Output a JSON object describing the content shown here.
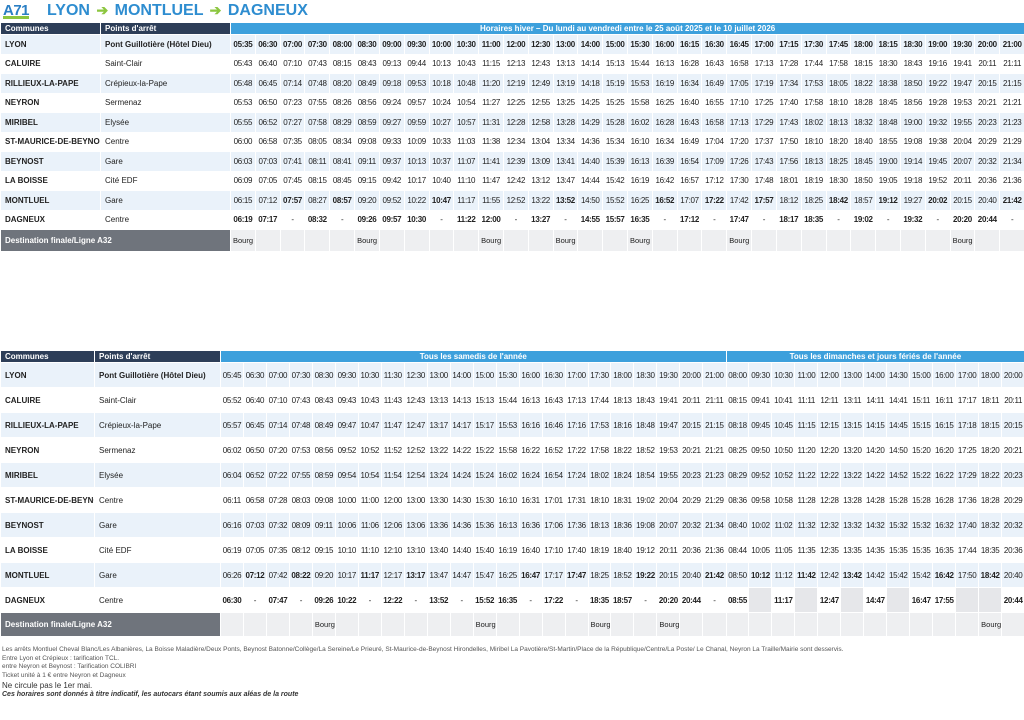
{
  "header": {
    "line": "A71",
    "from": "LYON",
    "via": "MONTLUEL",
    "to": "DAGNEUX"
  },
  "t1": {
    "col_communes": "Communes",
    "col_points": "Points d'arrêt",
    "banner": "Horaires hiver – Du lundi au vendredi entre le 25 août 2025 et le 10 juillet 2026",
    "times": [
      "05:35",
      "06:30",
      "07:00",
      "07:30",
      "08:00",
      "08:30",
      "09:00",
      "09:30",
      "10:00",
      "10:30",
      "11:00",
      "12:00",
      "12:30",
      "13:00",
      "14:00",
      "15:00",
      "15:30",
      "16:00",
      "16:15",
      "16:30",
      "16:45",
      "17:00",
      "17:15",
      "17:30",
      "17:45",
      "18:00",
      "18:15",
      "18:30",
      "19:00",
      "19:30",
      "20:00",
      "21:00"
    ],
    "rows": [
      {
        "commune": "LYON",
        "stop": "Pont Guillotière  (Hôtel Dieu)",
        "bold": true,
        "times": [
          "05:35",
          "06:30",
          "07:00",
          "07:30",
          "08:00",
          "08:30",
          "09:00",
          "09:30",
          "10:00",
          "10:30",
          "11:00",
          "12:00",
          "12:30",
          "13:00",
          "14:00",
          "15:00",
          "15:30",
          "16:00",
          "16:15",
          "16:30",
          "16:45",
          "17:00",
          "17:15",
          "17:30",
          "17:45",
          "18:00",
          "18:15",
          "18:30",
          "19:00",
          "19:30",
          "20:00",
          "21:00"
        ]
      },
      {
        "commune": "CALUIRE",
        "stop": "Saint-Clair",
        "times": [
          "05:43",
          "06:40",
          "07:10",
          "07:43",
          "08:15",
          "08:43",
          "09:13",
          "09:44",
          "10:13",
          "10:43",
          "11:15",
          "12:13",
          "12:43",
          "13:13",
          "14:14",
          "15:13",
          "15:44",
          "16:13",
          "16:28",
          "16:43",
          "16:58",
          "17:13",
          "17:28",
          "17:44",
          "17:58",
          "18:15",
          "18:30",
          "18:43",
          "19:16",
          "19:41",
          "20:11",
          "21:11"
        ]
      },
      {
        "commune": "RILLIEUX-LA-PAPE",
        "stop": "Crépieux-la-Pape",
        "times": [
          "05:48",
          "06:45",
          "07:14",
          "07:48",
          "08:20",
          "08:49",
          "09:18",
          "09:53",
          "10:18",
          "10:48",
          "11:20",
          "12:19",
          "12:49",
          "13:19",
          "14:18",
          "15:19",
          "15:53",
          "16:19",
          "16:34",
          "16:49",
          "17:05",
          "17:19",
          "17:34",
          "17:53",
          "18:05",
          "18:22",
          "18:38",
          "18:50",
          "19:22",
          "19:47",
          "20:15",
          "21:15"
        ]
      },
      {
        "commune": "NEYRON",
        "stop": "Sermenaz",
        "times": [
          "05:53",
          "06:50",
          "07:23",
          "07:55",
          "08:26",
          "08:56",
          "09:24",
          "09:57",
          "10:24",
          "10:54",
          "11:27",
          "12:25",
          "12:55",
          "13:25",
          "14:25",
          "15:25",
          "15:58",
          "16:25",
          "16:40",
          "16:55",
          "17:10",
          "17:25",
          "17:40",
          "17:58",
          "18:10",
          "18:28",
          "18:45",
          "18:56",
          "19:28",
          "19:53",
          "20:21",
          "21:21"
        ]
      },
      {
        "commune": "MIRIBEL",
        "stop": "Elysée",
        "times": [
          "05:55",
          "06:52",
          "07:27",
          "07:58",
          "08:29",
          "08:59",
          "09:27",
          "09:59",
          "10:27",
          "10:57",
          "11:31",
          "12:28",
          "12:58",
          "13:28",
          "14:29",
          "15:28",
          "16:02",
          "16:28",
          "16:43",
          "16:58",
          "17:13",
          "17:29",
          "17:43",
          "18:02",
          "18:13",
          "18:32",
          "18:48",
          "19:00",
          "19:32",
          "19:55",
          "20:23",
          "21:23"
        ]
      },
      {
        "commune": "ST-MAURICE-DE-BEYNOST",
        "stop": "Centre",
        "times": [
          "06:00",
          "06:58",
          "07:35",
          "08:05",
          "08:34",
          "09:08",
          "09:33",
          "10:09",
          "10:33",
          "11:03",
          "11:38",
          "12:34",
          "13:04",
          "13:34",
          "14:36",
          "15:34",
          "16:10",
          "16:34",
          "16:49",
          "17:04",
          "17:20",
          "17:37",
          "17:50",
          "18:10",
          "18:20",
          "18:40",
          "18:55",
          "19:08",
          "19:38",
          "20:04",
          "20:29",
          "21:29"
        ]
      },
      {
        "commune": "BEYNOST",
        "stop": "Gare",
        "times": [
          "06:03",
          "07:03",
          "07:41",
          "08:11",
          "08:41",
          "09:11",
          "09:37",
          "10:13",
          "10:37",
          "11:07",
          "11:41",
          "12:39",
          "13:09",
          "13:41",
          "14:40",
          "15:39",
          "16:13",
          "16:39",
          "16:54",
          "17:09",
          "17:26",
          "17:43",
          "17:56",
          "18:13",
          "18:25",
          "18:45",
          "19:00",
          "19:14",
          "19:45",
          "20:07",
          "20:32",
          "21:34"
        ]
      },
      {
        "commune": "LA BOISSE",
        "stop": "Cité EDF",
        "times": [
          "06:09",
          "07:05",
          "07:45",
          "08:15",
          "08:45",
          "09:15",
          "09:42",
          "10:17",
          "10:40",
          "11:10",
          "11:47",
          "12:42",
          "13:12",
          "13:47",
          "14:44",
          "15:42",
          "16:19",
          "16:42",
          "16:57",
          "17:12",
          "17:30",
          "17:48",
          "18:01",
          "18:19",
          "18:30",
          "18:50",
          "19:05",
          "19:18",
          "19:52",
          "20:11",
          "20:36",
          "21:36"
        ]
      },
      {
        "commune": "MONTLUEL",
        "stop": "Gare",
        "times": [
          "06:15",
          "07:12",
          "07:57",
          "08:27",
          "08:57",
          "09:20",
          "09:52",
          "10:22",
          "10:47",
          "11:17",
          "11:55",
          "12:52",
          "13:22",
          "13:52",
          "14:50",
          "15:52",
          "16:25",
          "16:52",
          "17:07",
          "17:22",
          "17:42",
          "17:57",
          "18:12",
          "18:25",
          "18:42",
          "18:57",
          "19:12",
          "19:27",
          "20:02",
          "20:15",
          "20:40",
          "21:42"
        ],
        "bold_idx": [
          2,
          4,
          8,
          13,
          17,
          19,
          21,
          24,
          26,
          28,
          31
        ]
      },
      {
        "commune": "DAGNEUX",
        "stop": "Centre",
        "times": [
          "06:19",
          "07:17",
          "-",
          "08:32",
          "-",
          "09:26",
          "09:57",
          "10:30",
          "-",
          "11:22",
          "12:00",
          "-",
          "13:27",
          "-",
          "14:55",
          "15:57",
          "16:35",
          "-",
          "17:12",
          "-",
          "17:47",
          "-",
          "18:17",
          "18:35",
          "-",
          "19:02",
          "-",
          "19:32",
          "-",
          "20:20",
          "20:44",
          "-"
        ],
        "all_bold": true
      }
    ],
    "dest_label": "Destination finale/Ligne A32",
    "dest": [
      "Bourg",
      "",
      "",
      "",
      "",
      "Bourg",
      "",
      "",
      "",
      "",
      "Bourg",
      "",
      "",
      "Bourg",
      "",
      "",
      "Bourg",
      "",
      "",
      "",
      "Bourg",
      "",
      "",
      "",
      "",
      "",
      "",
      "",
      "",
      "Bourg",
      "",
      ""
    ]
  },
  "t2": {
    "col_communes": "Communes",
    "col_points": "Points d'arrêt",
    "banner_sat": "Tous les samedis de l'année",
    "banner_sun": "Tous les dimanches et jours fériés de l'année",
    "rows": [
      {
        "commune": "LYON",
        "stop": "Pont Guillotière  (Hôtel Dieu)",
        "bold": true,
        "sat": [
          "05:45",
          "06:30",
          "07:00",
          "07:30",
          "08:30",
          "09:30",
          "10:30",
          "11:30",
          "12:30",
          "13:00",
          "14:00",
          "15:00",
          "15:30",
          "16:00",
          "16:30",
          "17:00",
          "17:30",
          "18:00",
          "18:30",
          "19:30",
          "20:00",
          "21:00"
        ],
        "sun": [
          "08:00",
          "09:30",
          "10:30",
          "11:00",
          "12:00",
          "13:00",
          "14:00",
          "14:30",
          "15:00",
          "16:00",
          "17:00",
          "18:00",
          "20:00"
        ]
      },
      {
        "commune": "CALUIRE",
        "stop": "Saint-Clair",
        "sat": [
          "05:52",
          "06:40",
          "07:10",
          "07:43",
          "08:43",
          "09:43",
          "10:43",
          "11:43",
          "12:43",
          "13:13",
          "14:13",
          "15:13",
          "15:44",
          "16:13",
          "16:43",
          "17:13",
          "17:44",
          "18:13",
          "18:43",
          "19:41",
          "20:11",
          "21:11"
        ],
        "sun": [
          "08:15",
          "09:41",
          "10:41",
          "11:11",
          "12:11",
          "13:11",
          "14:11",
          "14:41",
          "15:11",
          "16:11",
          "17:17",
          "18:11",
          "20:11"
        ]
      },
      {
        "commune": "RILLIEUX-LA-PAPE",
        "stop": "Crépieux-la-Pape",
        "sat": [
          "05:57",
          "06:45",
          "07:14",
          "07:48",
          "08:49",
          "09:47",
          "10:47",
          "11:47",
          "12:47",
          "13:17",
          "14:17",
          "15:17",
          "15:53",
          "16:16",
          "16:46",
          "17:16",
          "17:53",
          "18:16",
          "18:48",
          "19:47",
          "20:15",
          "21:15"
        ],
        "sun": [
          "08:18",
          "09:45",
          "10:45",
          "11:15",
          "12:15",
          "13:15",
          "14:15",
          "14:45",
          "15:15",
          "16:15",
          "17:18",
          "18:15",
          "20:15"
        ]
      },
      {
        "commune": "NEYRON",
        "stop": "Sermenaz",
        "sat": [
          "06:02",
          "06:50",
          "07:20",
          "07:53",
          "08:56",
          "09:52",
          "10:52",
          "11:52",
          "12:52",
          "13:22",
          "14:22",
          "15:22",
          "15:58",
          "16:22",
          "16:52",
          "17:22",
          "17:58",
          "18:22",
          "18:52",
          "19:53",
          "20:21",
          "21:21"
        ],
        "sun": [
          "08:25",
          "09:50",
          "10:50",
          "11:20",
          "12:20",
          "13:20",
          "14:20",
          "14:50",
          "15:20",
          "16:20",
          "17:25",
          "18:20",
          "20:21"
        ]
      },
      {
        "commune": "MIRIBEL",
        "stop": "Elysée",
        "sat": [
          "06:04",
          "06:52",
          "07:22",
          "07:55",
          "08:59",
          "09:54",
          "10:54",
          "11:54",
          "12:54",
          "13:24",
          "14:24",
          "15:24",
          "16:02",
          "16:24",
          "16:54",
          "17:24",
          "18:02",
          "18:24",
          "18:54",
          "19:55",
          "20:23",
          "21:23"
        ],
        "sun": [
          "08:29",
          "09:52",
          "10:52",
          "11:22",
          "12:22",
          "13:22",
          "14:22",
          "14:52",
          "15:22",
          "16:22",
          "17:29",
          "18:22",
          "20:23"
        ]
      },
      {
        "commune": "ST-MAURICE-DE-BEYNOST",
        "stop": "Centre",
        "sat": [
          "06:11",
          "06:58",
          "07:28",
          "08:03",
          "09:08",
          "10:00",
          "11:00",
          "12:00",
          "13:00",
          "13:30",
          "14:30",
          "15:30",
          "16:10",
          "16:31",
          "17:01",
          "17:31",
          "18:10",
          "18:31",
          "19:02",
          "20:04",
          "20:29",
          "21:29"
        ],
        "sun": [
          "08:36",
          "09:58",
          "10:58",
          "11:28",
          "12:28",
          "13:28",
          "14:28",
          "15:28",
          "15:28",
          "16:28",
          "17:36",
          "18:28",
          "20:29"
        ]
      },
      {
        "commune": "BEYNOST",
        "stop": "Gare",
        "sat": [
          "06:16",
          "07:03",
          "07:32",
          "08:09",
          "09:11",
          "10:06",
          "11:06",
          "12:06",
          "13:06",
          "13:36",
          "14:36",
          "15:36",
          "16:13",
          "16:36",
          "17:06",
          "17:36",
          "18:13",
          "18:36",
          "19:08",
          "20:07",
          "20:32",
          "21:34"
        ],
        "sun": [
          "08:40",
          "10:02",
          "11:02",
          "11:32",
          "12:32",
          "13:32",
          "14:32",
          "15:32",
          "15:32",
          "16:32",
          "17:40",
          "18:32",
          "20:32"
        ]
      },
      {
        "commune": "LA BOISSE",
        "stop": "Cité EDF",
        "sat": [
          "06:19",
          "07:05",
          "07:35",
          "08:12",
          "09:15",
          "10:10",
          "11:10",
          "12:10",
          "13:10",
          "13:40",
          "14:40",
          "15:40",
          "16:19",
          "16:40",
          "17:10",
          "17:40",
          "18:19",
          "18:40",
          "19:12",
          "20:11",
          "20:36",
          "21:36"
        ],
        "sun": [
          "08:44",
          "10:05",
          "11:05",
          "11:35",
          "12:35",
          "13:35",
          "14:35",
          "15:35",
          "15:35",
          "16:35",
          "17:44",
          "18:35",
          "20:36"
        ]
      },
      {
        "commune": "MONTLUEL",
        "stop": "Gare",
        "sat": [
          "06:26",
          "07:12",
          "07:42",
          "08:22",
          "09:20",
          "10:17",
          "11:17",
          "12:17",
          "13:17",
          "13:47",
          "14:47",
          "15:47",
          "16:25",
          "16:47",
          "17:17",
          "17:47",
          "18:25",
          "18:52",
          "19:22",
          "20:15",
          "20:40",
          "21:42"
        ],
        "sun": [
          "08:50",
          "10:12",
          "11:12",
          "11:42",
          "12:42",
          "13:42",
          "14:42",
          "15:42",
          "15:42",
          "16:42",
          "17:50",
          "18:42",
          "20:40"
        ],
        "sat_bold": [
          1,
          3,
          6,
          8,
          13,
          15,
          18,
          21
        ],
        "sun_bold": [
          1,
          3,
          5,
          9,
          11
        ]
      },
      {
        "commune": "DAGNEUX",
        "stop": "Centre",
        "sat": [
          "06:30",
          "-",
          "07:47",
          "-",
          "09:26",
          "10:22",
          "-",
          "12:22",
          "-",
          "13:52",
          "-",
          "15:52",
          "16:35",
          "-",
          "17:22",
          "-",
          "18:35",
          "18:57",
          "-",
          "20:20",
          "20:44",
          "-"
        ],
        "sun": [
          "08:55",
          "",
          "11:17",
          "",
          "12:47",
          "",
          "14:47",
          "",
          "16:47",
          "17:55",
          "",
          "",
          "20:44"
        ],
        "all_bold": true
      }
    ],
    "dest_label": "Destination finale/Ligne A32",
    "dest_sat": [
      "",
      "",
      "",
      "",
      "Bourg",
      "",
      "",
      "",
      "",
      "",
      "",
      "Bourg",
      "",
      "",
      "",
      "",
      "Bourg",
      "",
      "",
      "Bourg",
      "",
      ""
    ],
    "dest_sun": [
      "",
      "",
      "",
      "",
      "",
      "",
      "",
      "",
      "",
      "",
      "",
      "Bourg",
      ""
    ]
  },
  "notes": {
    "line1": "Les arrêts Montluel Cheval Blanc/Les Albanières, La Boisse Maladière/Deux Ponts, Beynost Batonne/Collège/La Sereine/Le Prieuré, St-Maurice-de-Beynost Hirondelles, Miribel La Pavotière/St-Martin/Place de la République/Centre/La Poste/ Le Chanal, Neyron La Traille/Mairie sont desservis.",
    "line2": "Entre Lyon et Crépieux : tarification TCL.",
    "line3": "entre Neyron et Beynost : Tarification COLIBRI",
    "line4": "Ticket unité à 1 € entre Neyron et Dagneux",
    "line5": "Ne circule pas le 1er mai.",
    "line6": "Ces horaires sont donnés à titre indicatif, les autocars étant soumis aux aléas de la route"
  }
}
